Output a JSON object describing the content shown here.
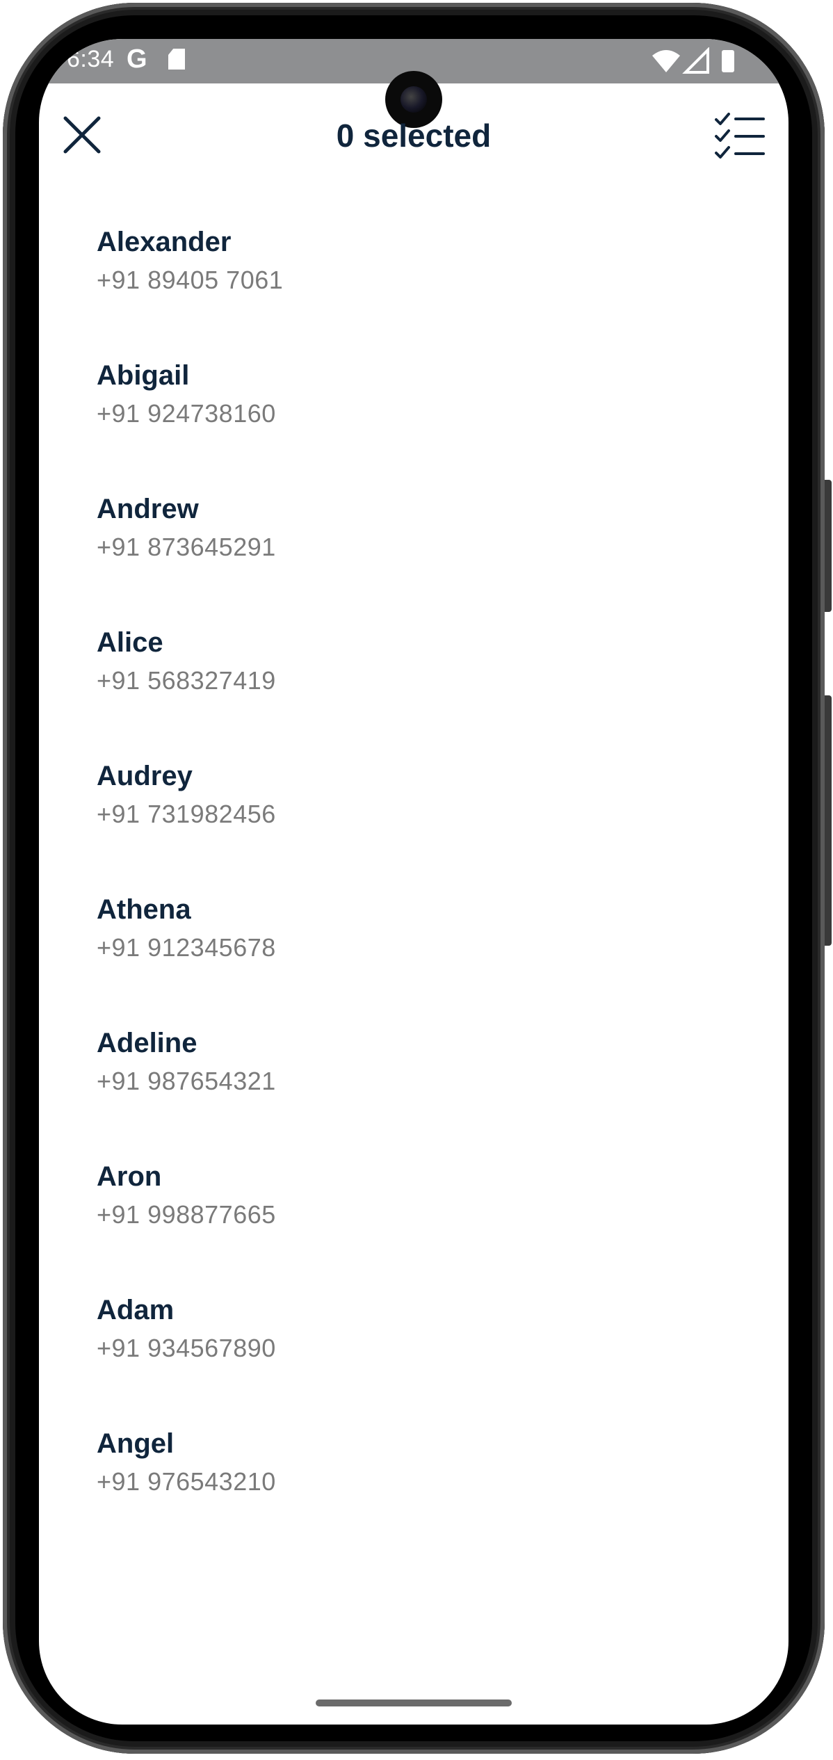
{
  "status_bar": {
    "time": "6:34",
    "google_glyph": "G",
    "icons": [
      "sd-card-icon",
      "wifi-icon",
      "signal-icon",
      "battery-icon"
    ]
  },
  "app_bar": {
    "title": "0 selected",
    "close_icon": "close-icon",
    "select_all_icon": "checklist-icon"
  },
  "contacts": [
    {
      "name": "Alexander",
      "phone": "+91 89405 7061"
    },
    {
      "name": "Abigail",
      "phone": "+91 924738160"
    },
    {
      "name": "Andrew",
      "phone": "+91 873645291"
    },
    {
      "name": "Alice",
      "phone": "+91 568327419"
    },
    {
      "name": "Audrey",
      "phone": "+91 731982456"
    },
    {
      "name": "Athena",
      "phone": "+91 912345678"
    },
    {
      "name": "Adeline",
      "phone": "+91 987654321"
    },
    {
      "name": "Aron",
      "phone": "+91 998877665"
    },
    {
      "name": "Adam",
      "phone": "+91 934567890"
    },
    {
      "name": "Angel",
      "phone": "+91 976543210"
    }
  ],
  "colors": {
    "name_text": "#10253c",
    "phone_text": "#7a7a7a",
    "status_bar": "#8e8f91",
    "background": "#ffffff"
  }
}
